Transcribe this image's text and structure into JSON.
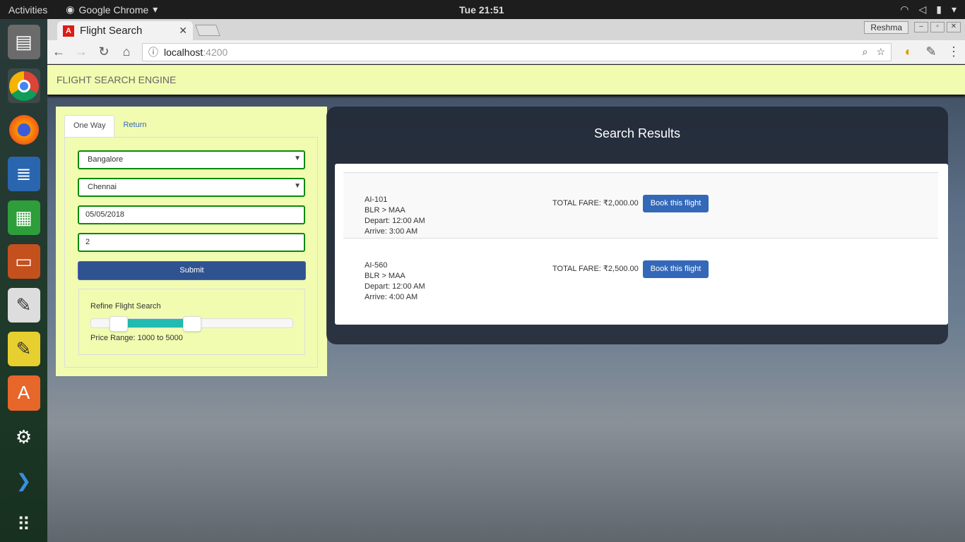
{
  "system": {
    "activities": "Activities",
    "app_name": "Google Chrome",
    "clock": "Tue 21:51"
  },
  "browser": {
    "tab_title": "Flight Search",
    "user": "Reshma",
    "url_host": "localhost",
    "url_port": ":4200"
  },
  "app": {
    "title": "FLIGHT SEARCH ENGINE"
  },
  "search": {
    "tabs": [
      {
        "label": "One Way"
      },
      {
        "label": "Return"
      }
    ],
    "origin": "Bangalore",
    "destination": "Chennai",
    "date": "05/05/2018",
    "passengers": "2",
    "submit_label": "Submit",
    "refine": {
      "title": "Refine Flight Search",
      "range_text": "Price Range: 1000 to 5000",
      "slider_min": 0,
      "slider_max": 10000,
      "low": 1000,
      "high": 5000
    }
  },
  "results": {
    "title": "Search Results",
    "flights": [
      {
        "code": "AI-101",
        "route": "BLR > MAA",
        "depart": "Depart: 12:00 AM",
        "arrive": "Arrive: 3:00 AM",
        "fare": "TOTAL FARE: ₹2,000.00",
        "book": "Book this flight"
      },
      {
        "code": "AI-560",
        "route": "BLR > MAA",
        "depart": "Depart: 12:00 AM",
        "arrive": "Arrive: 4:00 AM",
        "fare": "TOTAL FARE: ₹2,500.00",
        "book": "Book this flight"
      }
    ]
  }
}
